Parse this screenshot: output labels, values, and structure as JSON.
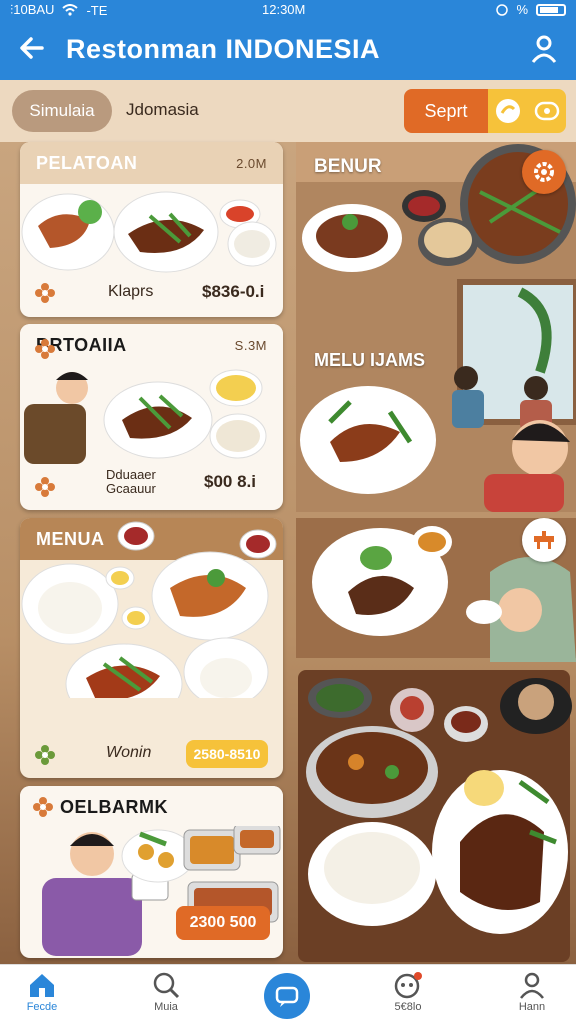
{
  "status_bar": {
    "left": "⫶10BAU",
    "carrier": "-TE",
    "time": "12:30M",
    "battery": "%"
  },
  "app_bar": {
    "title": "Restonman INDONESIA"
  },
  "filters": {
    "chip_1": "Simulaia",
    "chip_2": "Jdomasia",
    "search_label": "Seprt"
  },
  "left_cards": [
    {
      "header": "PELATOAN",
      "extra": "2.0M",
      "name": "Klaprs",
      "price": "$836-0.i"
    },
    {
      "header": "BRTOAIIA",
      "extra": "S.3M",
      "name": "Dduaaer\nGcaauur",
      "price": "$00 8.i"
    },
    {
      "header": "MENUA",
      "extra": "",
      "name": "Wonin",
      "price": "2580-8510"
    },
    {
      "header": "OELBARMK",
      "extra": "",
      "name": "",
      "price": "2300 500"
    }
  ],
  "right_labels": {
    "panel_1": "BENUR",
    "panel_2": "MELU IJAMS"
  },
  "bottom_nav": [
    {
      "label": "Fecde",
      "icon": "home-icon"
    },
    {
      "label": "Muia",
      "icon": "search-icon"
    },
    {
      "label": "",
      "icon": "chat-icon"
    },
    {
      "label": "5€8lo",
      "icon": "notification-icon"
    },
    {
      "label": "Hann",
      "icon": "user-icon"
    }
  ],
  "colors": {
    "primary": "#2a86d9",
    "accent": "#e06a26",
    "highlight": "#f6c23a",
    "card_bg": "#fbf6ef"
  }
}
